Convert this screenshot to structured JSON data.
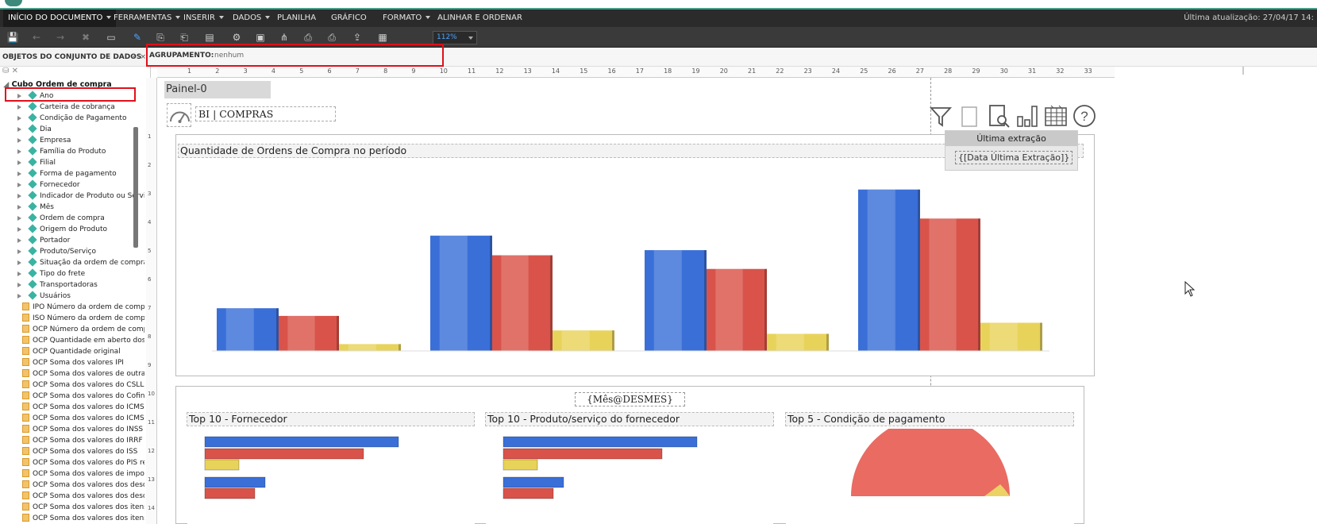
{
  "menu": {
    "items": [
      {
        "label": "INÍCIO DO DOCUMENTO",
        "caret": true,
        "active": true
      },
      {
        "label": "FERRAMENTAS",
        "caret": true
      },
      {
        "label": "INSERIR",
        "caret": true
      },
      {
        "label": "DADOS",
        "caret": true
      },
      {
        "label": "PLANILHA",
        "caret": false
      },
      {
        "label": "GRÁFICO",
        "caret": false
      },
      {
        "label": "FORMATO",
        "caret": true
      },
      {
        "label": "ALINHAR E ORDENAR",
        "caret": false
      }
    ],
    "last_update": "Última atualização: 27/04/17 14:"
  },
  "toolbar": {
    "zoom": "112%",
    "icons": [
      "save-icon",
      "undo-icon",
      "redo-icon",
      "delete-icon",
      "present-icon",
      "edit-icon",
      "copy-icon",
      "paste-icon",
      "duplicate-icon",
      "settings-icon",
      "bookmark-icon",
      "share-icon",
      "print-icon",
      "print-preview-icon",
      "export-icon",
      "layout-icon"
    ]
  },
  "left_panel": {
    "title": "OBJETOS DO CONJUNTO DE DADOS",
    "help": "?",
    "close": "×",
    "root": "Cubo Ordem de compra",
    "dimensions": [
      "Ano",
      "Carteira de cobrança",
      "Condição de Pagamento",
      "Dia",
      "Empresa",
      "Família do Produto",
      "Filial",
      "Forma de pagamento",
      "Fornecedor",
      "Indicador de Produto ou Serviço",
      "Mês",
      "Ordem de compra",
      "Origem do Produto",
      "Portador",
      "Produto/Serviço",
      "Situação da ordem de compra",
      "Tipo do frete",
      "Transportadoras",
      "Usuários"
    ],
    "measures": [
      "IPO Número da ordem de compra",
      "ISO Número da ordem de compra",
      "OCP Número da ordem de compra",
      "OCP Quantidade em aberto dos itens",
      "OCP Quantidade original",
      "OCP Soma dos valores IPI",
      "OCP Soma dos valores de outras",
      "OCP Soma dos valores do CSLL",
      "OCP Soma dos valores do Cofins",
      "OCP Soma dos valores do ICMS",
      "OCP Soma dos valores do ICMS ST",
      "OCP Soma dos valores do INSS",
      "OCP Soma dos valores do IRRF",
      "OCP Soma dos valores do ISS",
      "OCP Soma dos valores do PIS retido",
      "OCP Soma dos valores de impostos",
      "OCP Soma dos valores dos descontos",
      "OCP Soma dos valores dos descontos",
      "OCP Soma dos valores dos itens",
      "OCP Soma dos valores dos itens"
    ]
  },
  "grouping": {
    "label": "AGRUPAMENTO:",
    "value": "nenhum"
  },
  "ruler": {
    "h": [
      "1",
      "2",
      "3",
      "4",
      "5",
      "6",
      "7",
      "8",
      "9",
      "10",
      "11",
      "12",
      "13",
      "14",
      "15",
      "16",
      "17",
      "18",
      "19",
      "20",
      "21",
      "22",
      "23",
      "24",
      "25",
      "26",
      "27",
      "28",
      "29",
      "30",
      "31",
      "32",
      "33"
    ],
    "v": [
      "1",
      "2",
      "3",
      "4",
      "5",
      "6",
      "7",
      "8",
      "9",
      "10",
      "11",
      "12",
      "13",
      "14"
    ]
  },
  "canvas": {
    "panel_name": "Painel-0",
    "dashboard_title": "BI | COMPRAS",
    "tooltip_title": "Última extração",
    "tooltip_value": "{[Data Última Extração]}",
    "month_label": "{Mês@DESMES}"
  },
  "chart_data": [
    {
      "type": "bar",
      "title": "Quantidade de Ordens de Compra no período",
      "categories": [
        "",
        "",
        "",
        ""
      ],
      "series": [
        {
          "color": "#3a6fd8",
          "values": [
            50,
            135,
            118,
            189
          ]
        },
        {
          "color": "#d9534a",
          "values": [
            41,
            112,
            96,
            155
          ]
        },
        {
          "color": "#e8d35a",
          "values": [
            8,
            24,
            20,
            33
          ]
        }
      ],
      "ylim": [
        0,
        200
      ]
    },
    {
      "type": "bar",
      "title": "Top 10 - Fornecedor",
      "orientation": "horizontal",
      "series": [
        {
          "color": "#3a6fd8",
          "values": [
            244,
            76
          ]
        },
        {
          "color": "#d9534a",
          "values": [
            200,
            63
          ]
        },
        {
          "color": "#e8d35a",
          "values": [
            43
          ]
        }
      ]
    },
    {
      "type": "bar",
      "title": "Top 10 - Produto/serviço do fornecedor",
      "orientation": "horizontal",
      "series": [
        {
          "color": "#3a6fd8",
          "values": [
            244,
            76
          ]
        },
        {
          "color": "#d9534a",
          "values": [
            200,
            63
          ]
        },
        {
          "color": "#e8d35a",
          "values": [
            43
          ]
        }
      ]
    },
    {
      "type": "pie",
      "title": "Top 5 - Condição de pagamento"
    }
  ],
  "colors": {
    "accent": "#4aa3ff",
    "highlight": "#e0101a",
    "teal": "#3bb3a3"
  }
}
